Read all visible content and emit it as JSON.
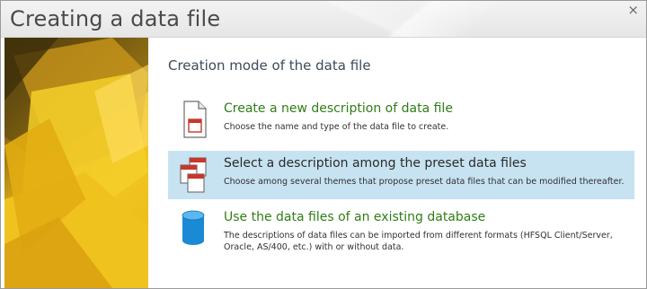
{
  "window": {
    "title": "Creating a data file",
    "close_glyph": "×"
  },
  "main": {
    "section_title": "Creation mode of the data file",
    "options": [
      {
        "title": "Create a new description of data file",
        "description": "Choose the name and type of the data file to create.",
        "icon": "new-file-icon",
        "selected": false
      },
      {
        "title": "Select a description among the preset data files",
        "description": "Choose among several themes that propose preset data files that can be modified thereafter.",
        "icon": "preset-files-icon",
        "selected": true
      },
      {
        "title": "Use the data files of an existing database",
        "description": "The descriptions of data files can be imported from different formats (HFSQL Client/Server, Oracle, AS/400, etc.) with or without data.",
        "icon": "database-icon",
        "selected": false
      }
    ]
  },
  "colors": {
    "selected_background": "#c7e3f2",
    "option_title": "#2f7d16",
    "accent_red": "#c8372b",
    "database_blue": "#1a8ad4"
  }
}
